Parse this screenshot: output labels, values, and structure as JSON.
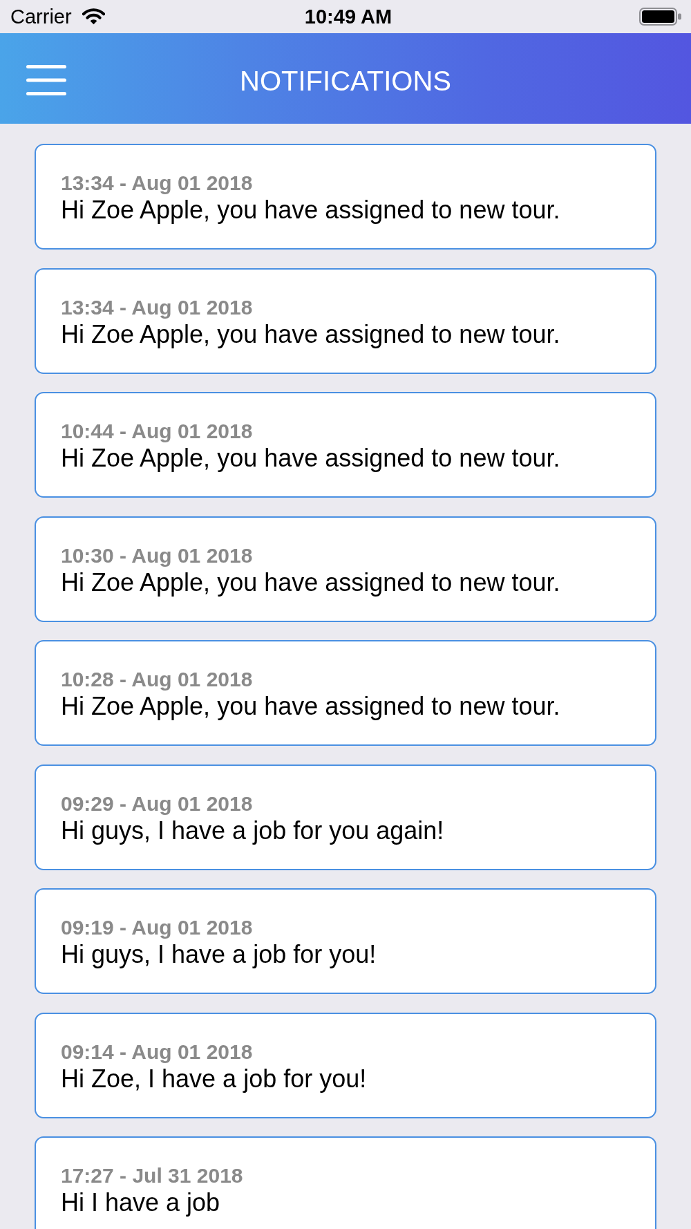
{
  "status_bar": {
    "carrier": "Carrier",
    "time": "10:49 AM"
  },
  "header": {
    "title": "NOTIFICATIONS"
  },
  "notifications": [
    {
      "timestamp": "13:34 - Aug 01 2018",
      "message": "Hi Zoe Apple, you have assigned to new tour."
    },
    {
      "timestamp": "13:34 - Aug 01 2018",
      "message": "Hi Zoe Apple, you have assigned to new tour."
    },
    {
      "timestamp": "10:44 - Aug 01 2018",
      "message": "Hi Zoe Apple, you have assigned to new tour."
    },
    {
      "timestamp": "10:30 - Aug 01 2018",
      "message": "Hi Zoe Apple, you have assigned to new tour."
    },
    {
      "timestamp": "10:28 - Aug 01 2018",
      "message": "Hi Zoe Apple, you have assigned to new tour."
    },
    {
      "timestamp": "09:29 - Aug 01 2018",
      "message": "Hi guys, I have a job for you again!"
    },
    {
      "timestamp": "09:19 - Aug 01 2018",
      "message": "Hi guys, I have a job for you!"
    },
    {
      "timestamp": "09:14 - Aug 01 2018",
      "message": "Hi Zoe, I have a job for you!"
    },
    {
      "timestamp": "17:27 - Jul 31 2018",
      "message": "Hi I have a job"
    }
  ]
}
